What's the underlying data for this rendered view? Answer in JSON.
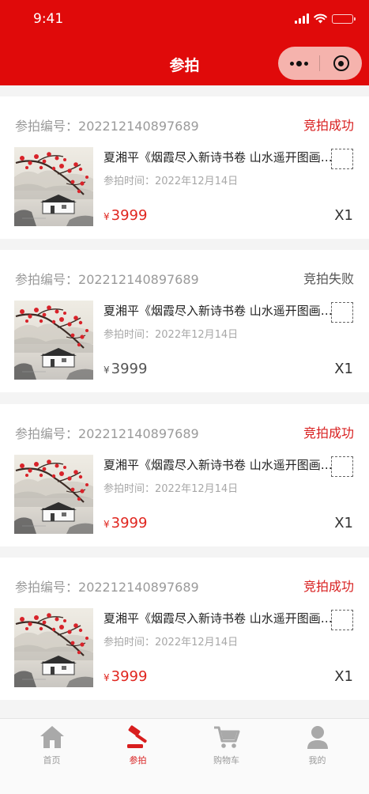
{
  "status_bar": {
    "time": "9:41"
  },
  "nav": {
    "title": "参拍"
  },
  "colors": {
    "brand": "#e00a0a",
    "success": "#d81e1e",
    "fail": "#555555",
    "price_active": "#e0261f"
  },
  "icons": {
    "menu": "more-dots-icon",
    "close": "target-close-icon"
  },
  "orders": [
    {
      "no_label": "参拍编号：",
      "no": "202212140897689",
      "status": "竞拍成功",
      "status_type": "success",
      "title": "夏湘平《烟霞尽入新诗书卷 山水遥开图画屏》",
      "time_label": "参拍时间：",
      "time": "2022年12月14日",
      "currency": "¥",
      "price": "3999",
      "qty": "X1",
      "price_active": true
    },
    {
      "no_label": "参拍编号：",
      "no": "202212140897689",
      "status": "竞拍失败",
      "status_type": "fail",
      "title": "夏湘平《烟霞尽入新诗书卷 山水遥开图画屏》",
      "time_label": "参拍时间：",
      "time": "2022年12月14日",
      "currency": "¥",
      "price": "3999",
      "qty": "X1",
      "price_active": false
    },
    {
      "no_label": "参拍编号：",
      "no": "202212140897689",
      "status": "竞拍成功",
      "status_type": "success",
      "title": "夏湘平《烟霞尽入新诗书卷 山水遥开图画屏》",
      "time_label": "参拍时间：",
      "time": "2022年12月14日",
      "currency": "¥",
      "price": "3999",
      "qty": "X1",
      "price_active": true
    },
    {
      "no_label": "参拍编号：",
      "no": "202212140897689",
      "status": "竞拍成功",
      "status_type": "success",
      "title": "夏湘平《烟霞尽入新诗书卷 山水遥开图画屏》",
      "time_label": "参拍时间：",
      "time": "2022年12月14日",
      "currency": "¥",
      "price": "3999",
      "qty": "X1",
      "price_active": true
    }
  ],
  "tabbar": {
    "items": [
      {
        "label": "首页",
        "icon": "home-icon",
        "active": false
      },
      {
        "label": "参拍",
        "icon": "auction-gavel-icon",
        "active": true
      },
      {
        "label": "购物车",
        "icon": "cart-icon",
        "active": false
      },
      {
        "label": "我的",
        "icon": "user-icon",
        "active": false
      }
    ]
  }
}
